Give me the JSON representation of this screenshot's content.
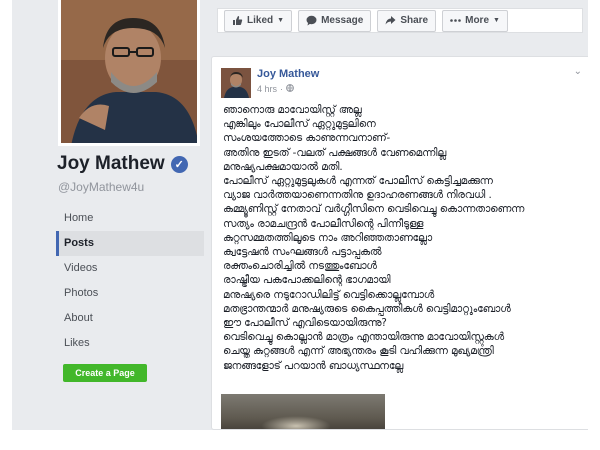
{
  "profile": {
    "name": "Joy Mathew",
    "handle": "@JoyMathew4u"
  },
  "nav": {
    "items": [
      {
        "label": "Home"
      },
      {
        "label": "Posts"
      },
      {
        "label": "Videos"
      },
      {
        "label": "Photos"
      },
      {
        "label": "About"
      },
      {
        "label": "Likes"
      }
    ],
    "active": "Posts"
  },
  "create_page": {
    "label": "Create a Page"
  },
  "actions": {
    "liked": "Liked",
    "message": "Message",
    "share": "Share",
    "more": "More"
  },
  "post": {
    "author": "Joy Mathew",
    "time": "4 hrs",
    "lines": [
      "ഞാനൊരു മാവോയിസ്റ്റ് അല്ല",
      "എങ്കിലും പോലീസ് ഏറ്റുമുട്ടലിനെ",
      "സംശയത്തോടെ കാണുന്നവനാണ്-",
      "അതിനു ഇടത് -വലത് പക്ഷങ്ങൾ വേണമെന്നില്ല",
      "മനുഷ്യപക്ഷമായാൽ മതി.",
      "പോലീസ് ഏറ്റുമുട്ടലുകൾ എന്നത് പോലീസ് കെട്ടിച്ചമക്കുന്ന",
      "വ്യാജ വാർത്തയാണെന്നതിനു ഉദാഹരണങ്ങൾ നിരവധി .",
      "കമ്മ്യൂണിസ്റ്റ് നേതാവ് വർഗ്ഗീസിനെ വെടിവെച്ചു കൊന്നതാണെന്ന",
      "സത്യം രാമചന്ദ്രൻ പോലീസിന്റെ പിന്നീടുള്ള",
      "കുറ്റസമ്മതത്തിലൂടെ നാം അറിഞ്ഞതാണല്ലോ",
      "ക്വട്ടേഷൻ സംഘങ്ങൾ പട്ടാപ്പകൽ",
      "രക്തംചൊരിച്ചിൽ നടത്തുംബോൾ",
      "രാഷ്ട്രീയ പകപോക്കലിന്റെ ഭാഗമായി",
      "മനുഷ്യരെ നടുറോഡിലിട്ട് വെട്ടിക്കൊല്ലുമ്പോൾ",
      "മതഭ്രാന്തന്മാർ മനുഷ്യരുടെ കൈപ്പത്തികൾ വെട്ടിമാറ്റുംബോൾ",
      "ഈ പോലീസ് എവിടെയായിരുന്നു?",
      "വെടിവെച്ചു കൊല്ലാൻ മാത്രം എന്തായിരുന്നു മാവോയിസ്റ്റുകൾ",
      "ചെയ്ത കുറ്റങ്ങൾ എന്ന് അഭ്യന്തരം കൂടി വഹിക്കുന്ന മുഖ്യമന്ത്രി",
      "ജനങ്ങളോട് പറയാൻ ബാധ്യസ്ഥനല്ലേ"
    ]
  },
  "colors": {
    "fb_blue": "#4267b2",
    "link_blue": "#365899",
    "green": "#42b72a",
    "bg_gray": "#e9ebee"
  }
}
